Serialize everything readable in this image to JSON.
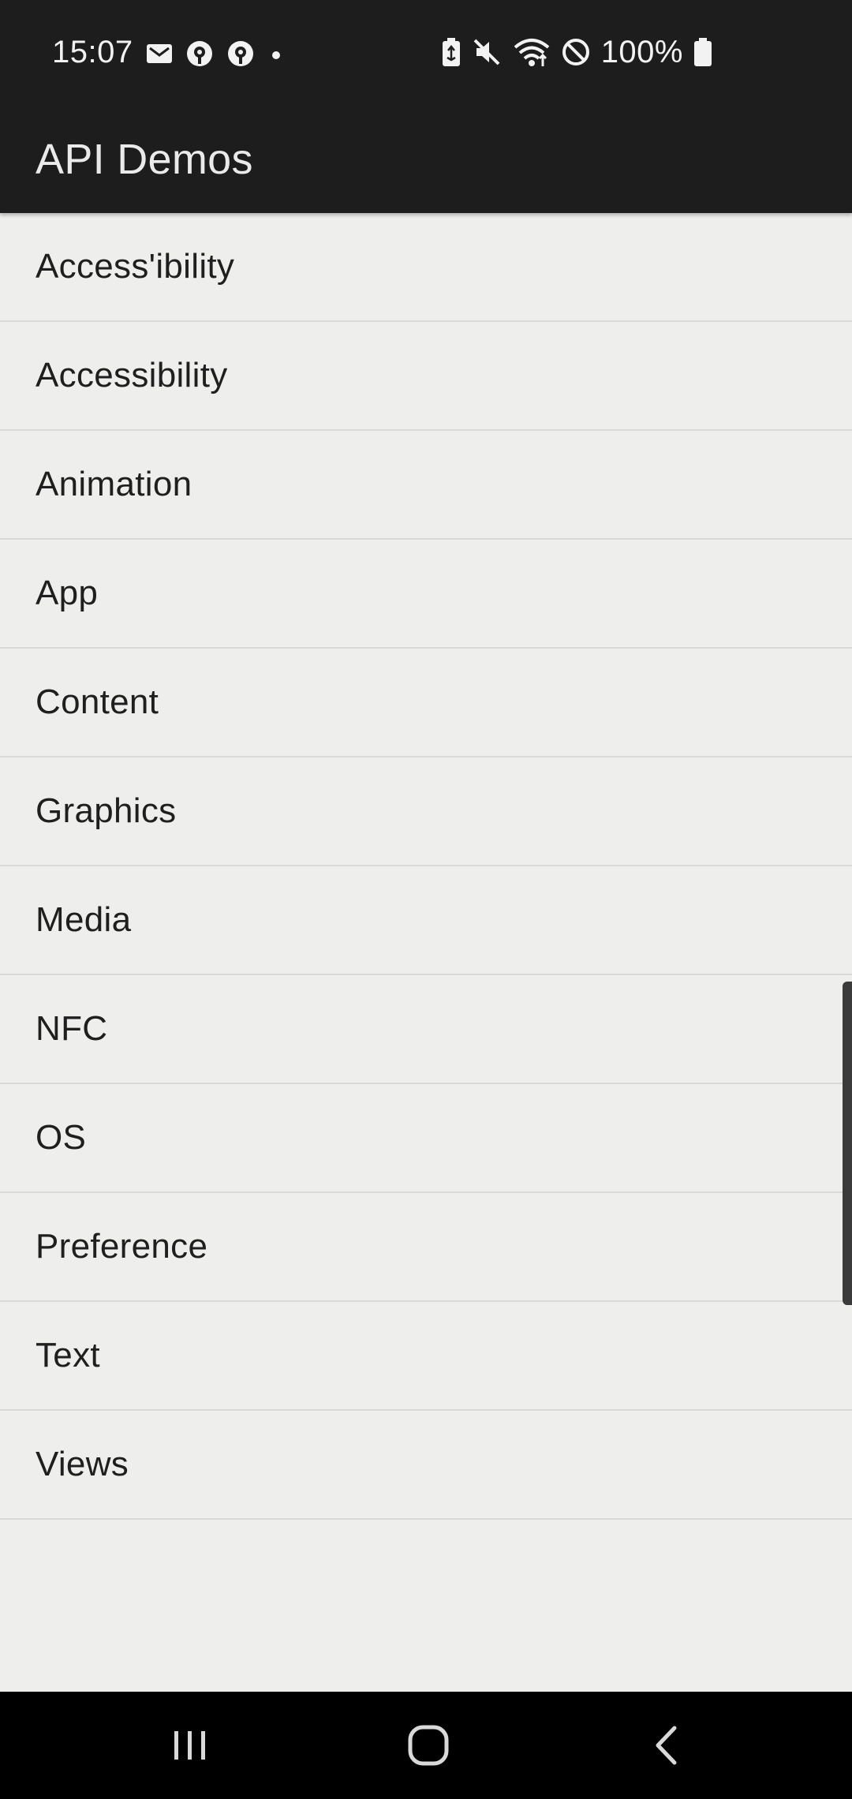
{
  "status_bar": {
    "time": "15:07",
    "battery_percent": "100%",
    "left_icons": [
      "gmail-icon",
      "location-pin-icon",
      "location-pin-icon",
      "notification-dot-icon"
    ],
    "right_icons": [
      "battery-saver-icon",
      "mute-icon",
      "wifi-icon",
      "do-not-disturb-icon",
      "battery-icon"
    ]
  },
  "app_bar": {
    "title": "API Demos",
    "background": "#1c1d1c"
  },
  "list": {
    "items": [
      {
        "label": "Access'ibility"
      },
      {
        "label": "Accessibility"
      },
      {
        "label": "Animation"
      },
      {
        "label": "App"
      },
      {
        "label": "Content"
      },
      {
        "label": "Graphics"
      },
      {
        "label": "Media"
      },
      {
        "label": "NFC"
      },
      {
        "label": "OS"
      },
      {
        "label": "Preference"
      },
      {
        "label": "Text"
      },
      {
        "label": "Views"
      }
    ]
  },
  "nav_bar": {
    "buttons": [
      "recent-apps-icon",
      "home-icon",
      "back-icon"
    ]
  }
}
